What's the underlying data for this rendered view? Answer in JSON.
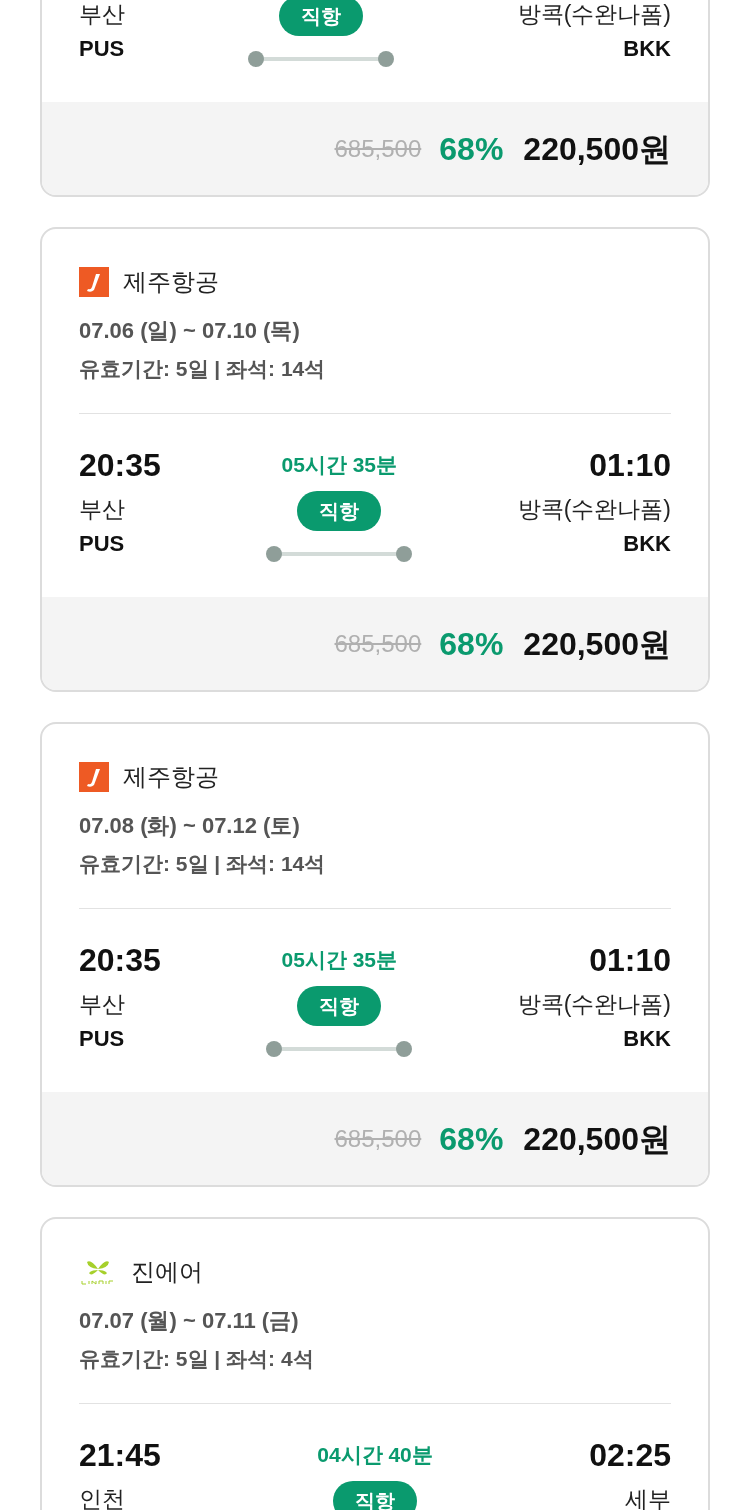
{
  "flights": [
    {
      "from": {
        "name": "부산",
        "code": "PUS"
      },
      "to": {
        "name": "방콕(수완나폼)",
        "code": "BKK"
      },
      "badge": "직항",
      "price": {
        "original": "685,500",
        "discount": "68%",
        "final": "220,500원"
      }
    },
    {
      "airline": {
        "name": "제주항공",
        "kind": "jeju"
      },
      "dates": "07.06 (일) ~ 07.10 (목)",
      "meta": "유효기간: 5일 | 좌석: 14석",
      "depart_time": "20:35",
      "arrive_time": "01:10",
      "duration": "05시간 35분",
      "from": {
        "name": "부산",
        "code": "PUS"
      },
      "to": {
        "name": "방콕(수완나폼)",
        "code": "BKK"
      },
      "badge": "직항",
      "price": {
        "original": "685,500",
        "discount": "68%",
        "final": "220,500원"
      }
    },
    {
      "airline": {
        "name": "제주항공",
        "kind": "jeju"
      },
      "dates": "07.08 (화) ~ 07.12 (토)",
      "meta": "유효기간: 5일 | 좌석: 14석",
      "depart_time": "20:35",
      "arrive_time": "01:10",
      "duration": "05시간 35분",
      "from": {
        "name": "부산",
        "code": "PUS"
      },
      "to": {
        "name": "방콕(수완나폼)",
        "code": "BKK"
      },
      "badge": "직항",
      "price": {
        "original": "685,500",
        "discount": "68%",
        "final": "220,500원"
      }
    },
    {
      "airline": {
        "name": "진에어",
        "kind": "jinair"
      },
      "dates": "07.07 (월) ~ 07.11 (금)",
      "meta": "유효기간: 5일 | 좌석: 4석",
      "depart_time": "21:45",
      "arrive_time": "02:25",
      "duration": "04시간 40분",
      "from": {
        "name": "인천"
      },
      "to": {
        "name": "세부"
      },
      "badge": "직항"
    }
  ]
}
